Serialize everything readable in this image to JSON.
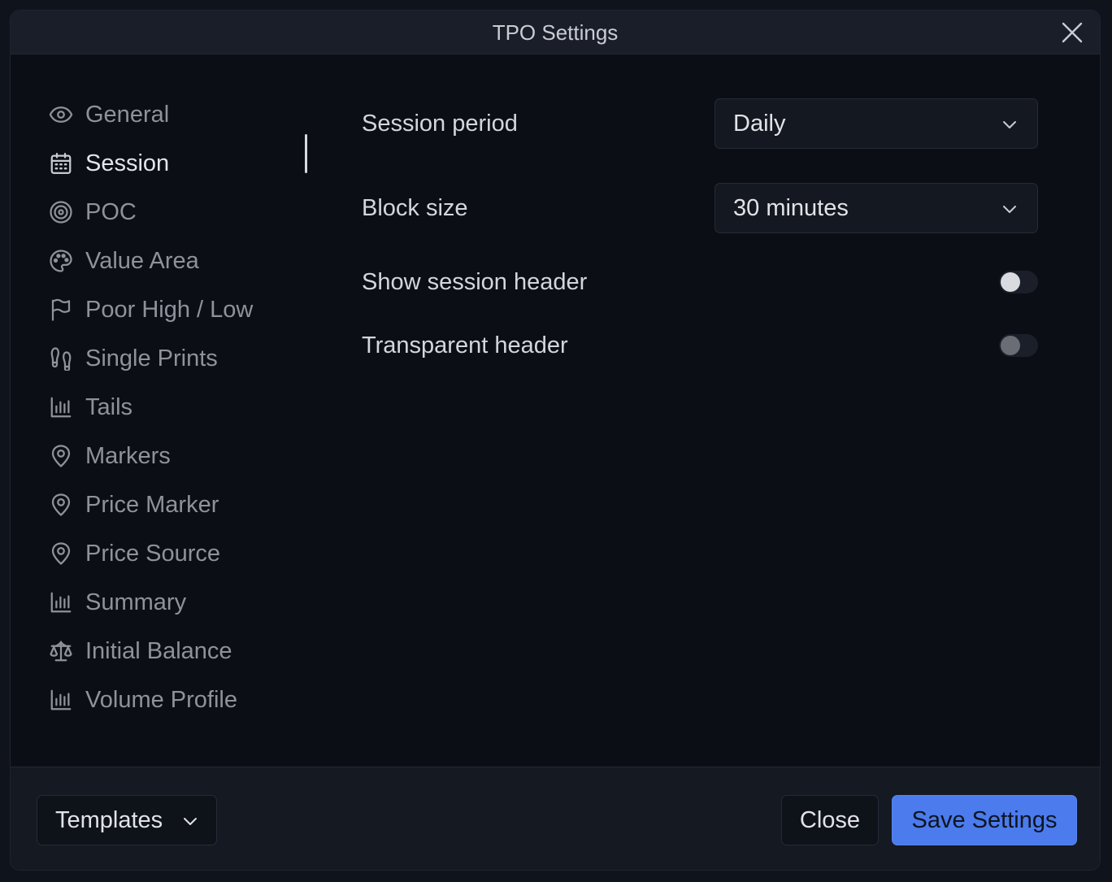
{
  "dialog": {
    "title": "TPO Settings"
  },
  "sidebar": {
    "active_index": 1,
    "items": [
      {
        "label": "General",
        "icon": "eye-icon"
      },
      {
        "label": "Session",
        "icon": "calendar-icon"
      },
      {
        "label": "POC",
        "icon": "target-icon"
      },
      {
        "label": "Value Area",
        "icon": "palette-icon"
      },
      {
        "label": "Poor High / Low",
        "icon": "flag-icon"
      },
      {
        "label": "Single Prints",
        "icon": "footprints-icon"
      },
      {
        "label": "Tails",
        "icon": "bar-chart-icon"
      },
      {
        "label": "Markers",
        "icon": "map-pin-icon"
      },
      {
        "label": "Price Marker",
        "icon": "map-pin-icon"
      },
      {
        "label": "Price Source",
        "icon": "map-pin-icon"
      },
      {
        "label": "Summary",
        "icon": "bar-chart-icon"
      },
      {
        "label": "Initial Balance",
        "icon": "scale-icon"
      },
      {
        "label": "Volume Profile",
        "icon": "bar-chart-icon"
      }
    ]
  },
  "settings": {
    "session_period": {
      "label": "Session period",
      "value": "Daily"
    },
    "block_size": {
      "label": "Block size",
      "value": "30 minutes"
    },
    "show_session_header": {
      "label": "Show session header",
      "enabled": false
    },
    "transparent_header": {
      "label": "Transparent header",
      "enabled": false
    }
  },
  "footer": {
    "templates_label": "Templates",
    "close_label": "Close",
    "save_label": "Save Settings"
  },
  "colors": {
    "accent": "#4b7bec",
    "background": "#0b0e15",
    "titlebar": "#1a1e28",
    "text_active": "#e3e5ea",
    "text_muted": "#8e929b"
  }
}
